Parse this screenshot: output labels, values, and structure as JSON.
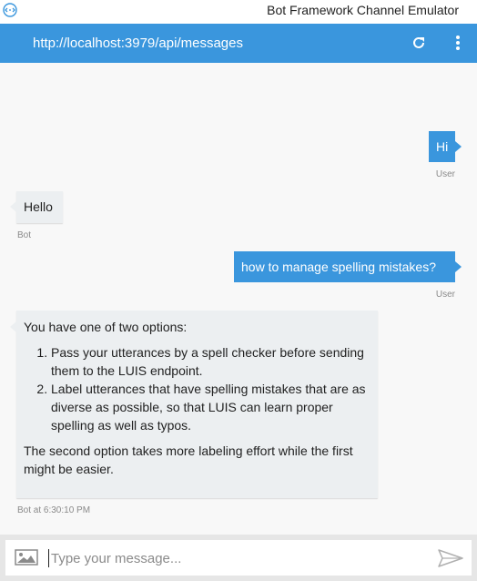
{
  "window": {
    "title": "Bot Framework Channel Emulator"
  },
  "addressbar": {
    "url": "http://localhost:3979/api/messages"
  },
  "messages": [
    {
      "from": "user",
      "text": "Hi",
      "meta": "User"
    },
    {
      "from": "bot",
      "text": "Hello",
      "meta": "Bot"
    },
    {
      "from": "user",
      "text": "how to manage spelling mistakes?",
      "meta": "User"
    },
    {
      "from": "bot",
      "intro": "You have one of two options:",
      "list": [
        "Pass your utterances by a spell checker before sending them to the LUIS endpoint.",
        "Label utterances that have spelling mistakes that are as diverse as possible, so that LUIS can learn proper spelling as well as typos."
      ],
      "outro": "The second option takes more labeling effort while the first might be easier.",
      "meta": "Bot at 6:30:10 PM"
    }
  ],
  "composer": {
    "placeholder": "Type your message..."
  },
  "colors": {
    "accent": "#3a96dd",
    "bot_bubble": "#eceff1",
    "chat_background": "#f8f8f8",
    "composer_background": "#e6e6e6"
  }
}
